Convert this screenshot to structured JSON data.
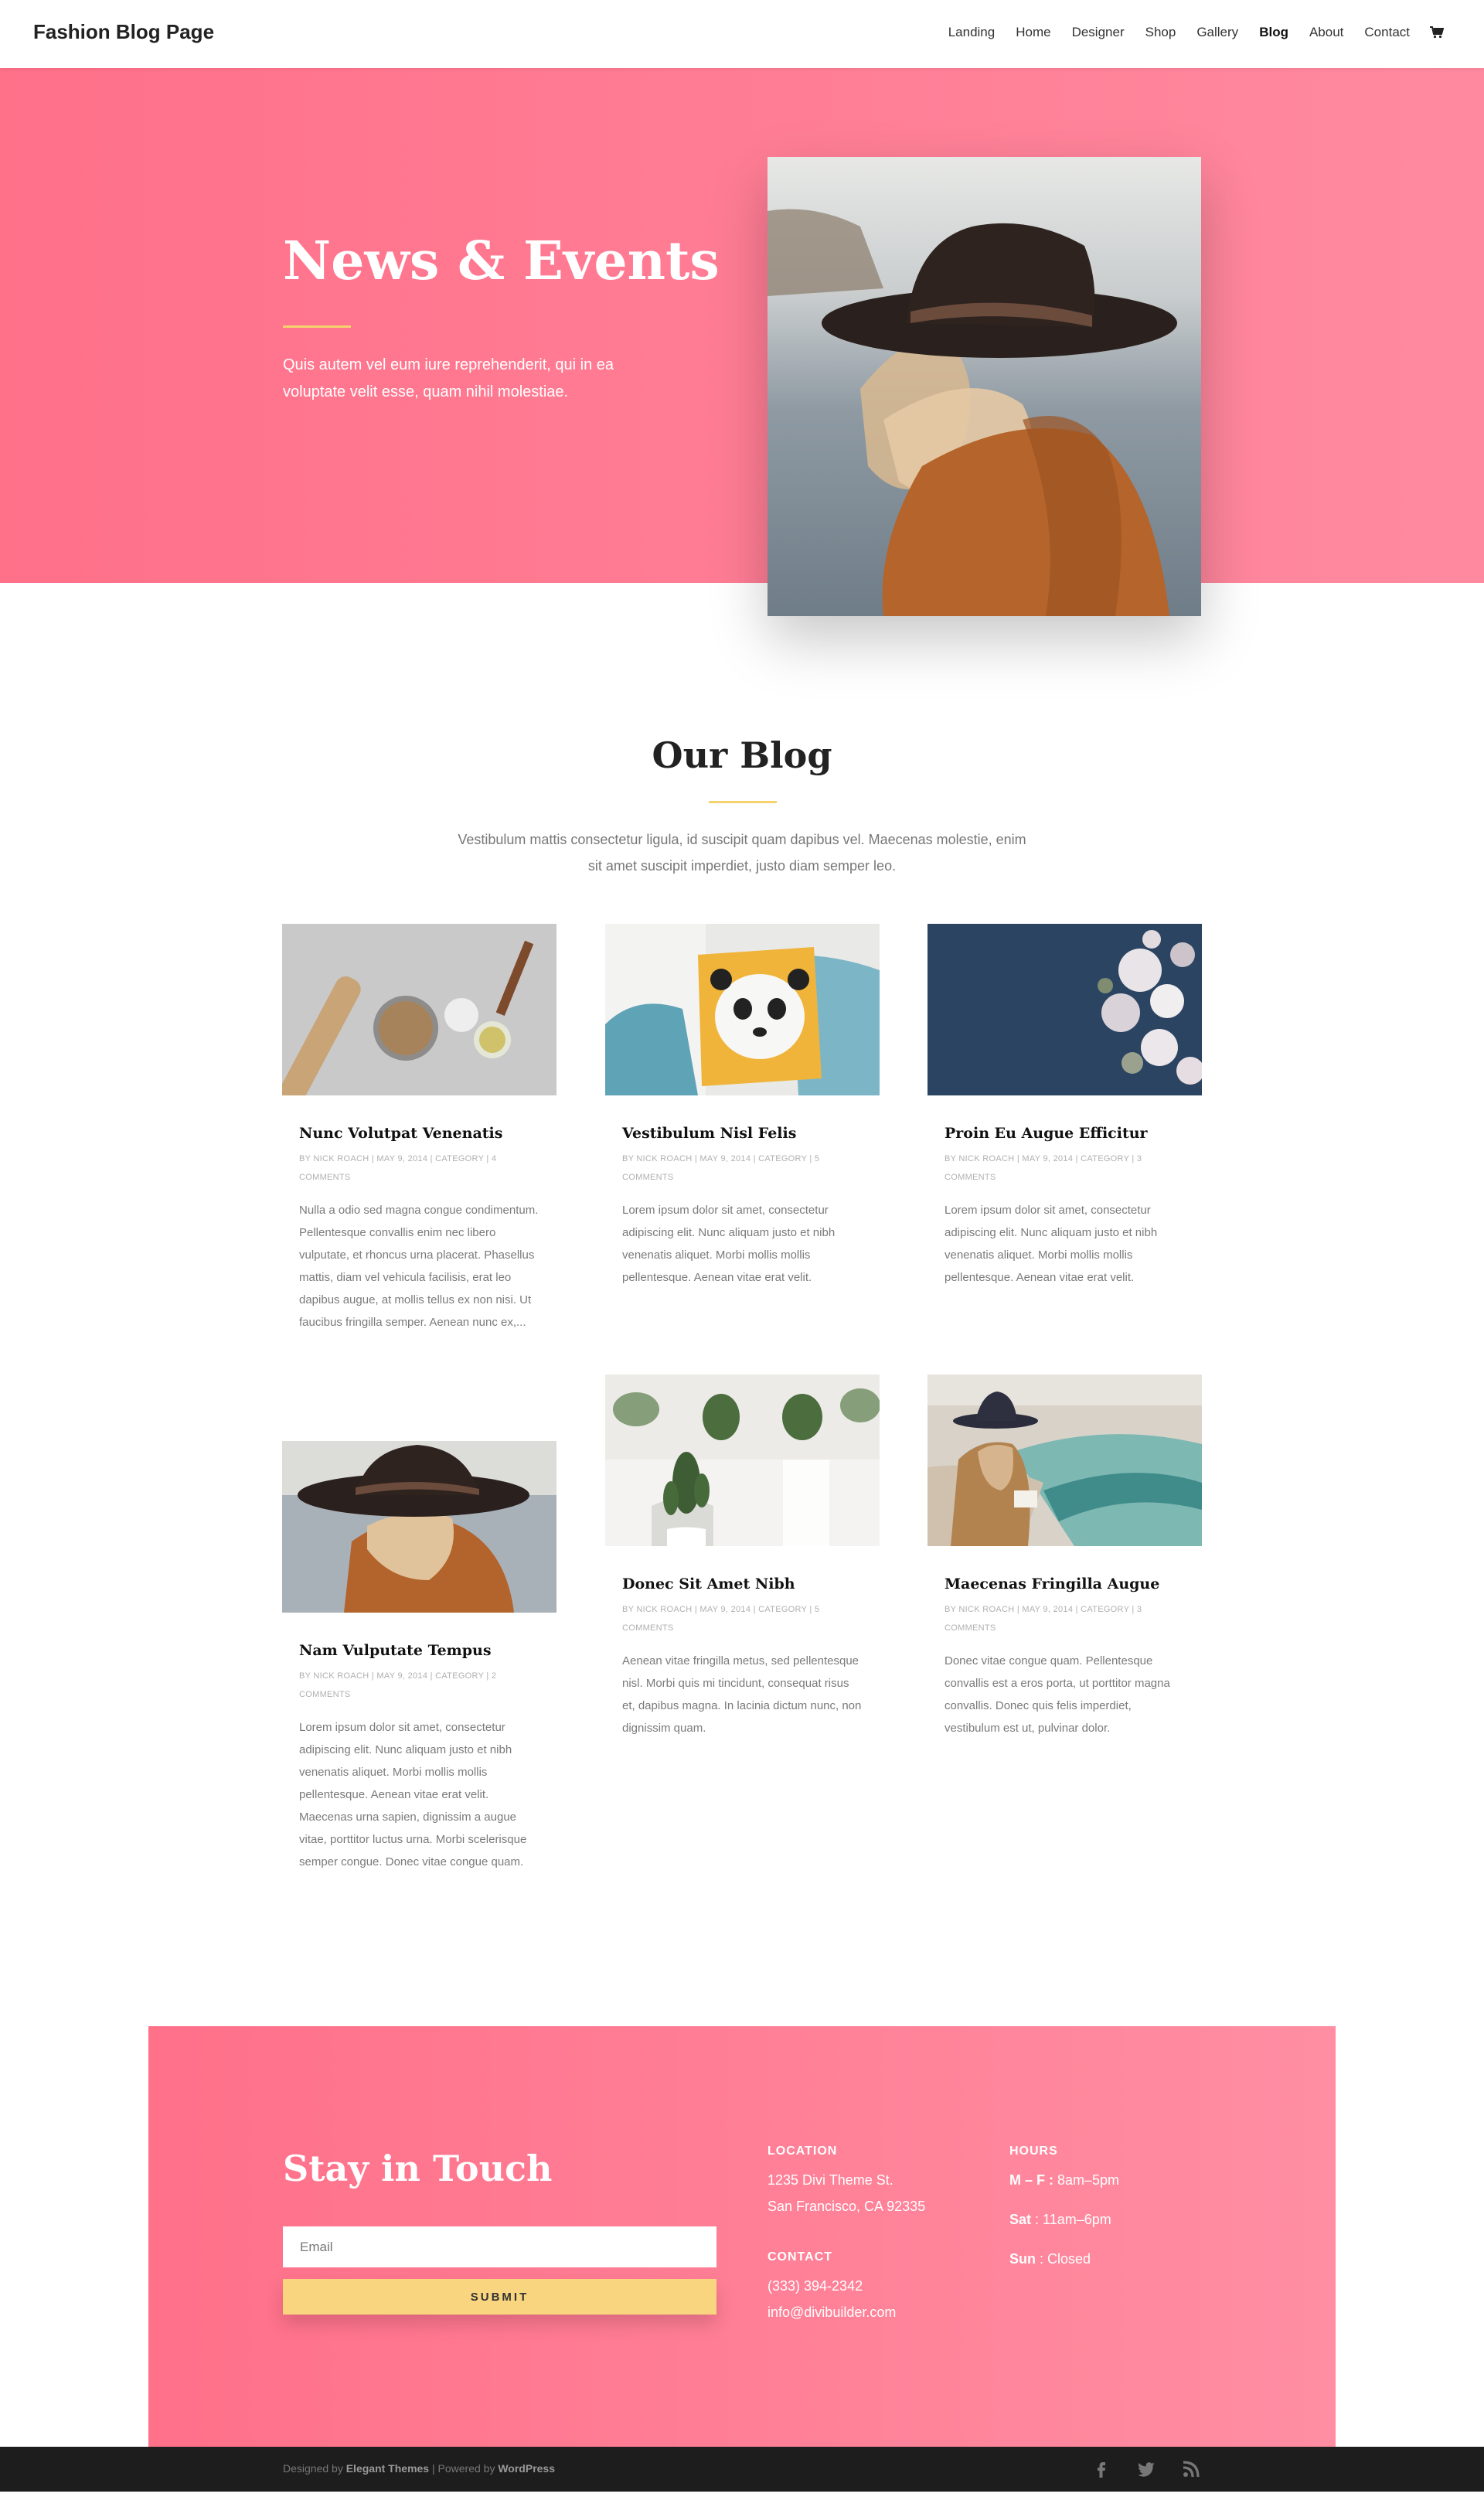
{
  "header": {
    "logo": "Fashion Blog Page",
    "nav": [
      "Landing",
      "Home",
      "Designer",
      "Shop",
      "Gallery",
      "Blog",
      "About",
      "Contact"
    ],
    "active": "Blog",
    "cart_icon": "cart-icon"
  },
  "hero": {
    "title": "News & Events",
    "text": "Quis autem vel eum iure reprehenderit, qui in ea voluptate velit esse, quam nihil molestiae.",
    "image": "woman-in-hat-photo"
  },
  "blog": {
    "title": "Our Blog",
    "intro": "Vestibulum mattis consectetur ligula, id suscipit quam dapibus vel. Maecenas molestie, enim sit amet suscipit imperdiet, justo diam semper leo.",
    "posts": [
      {
        "title": "Nunc Volutpat Venenatis",
        "meta": "BY NICK ROACH | MAY 9, 2014 | CATEGORY | 4 COMMENTS",
        "excerpt": "Nulla a odio sed magna congue condimentum. Pellentesque convallis enim nec libero vulputate, et rhoncus urna placerat. Phasellus mattis, diam vel vehicula facilisis, erat leo dapibus augue, at mollis tellus ex non nisi. Ut faucibus fringilla semper. Aenean nunc ex,...",
        "image": "baking-ingredients-photo"
      },
      {
        "title": "Vestibulum Nisl Felis",
        "meta": "BY NICK ROACH | MAY 9, 2014 | CATEGORY | 5 COMMENTS",
        "excerpt": "Lorem ipsum dolor sit amet, consectetur adipiscing elit. Nunc aliquam justo et nibh venenatis aliquet. Morbi mollis mollis pellentesque. Aenean vitae erat velit.",
        "image": "panda-pillow-photo"
      },
      {
        "title": "Proin Eu Augue Efficitur",
        "meta": "BY NICK ROACH | MAY 9, 2014 | CATEGORY | 3 COMMENTS",
        "excerpt": "Lorem ipsum dolor sit amet, consectetur adipiscing elit. Nunc aliquam justo et nibh venenatis aliquet. Morbi mollis mollis pellentesque. Aenean vitae erat velit.",
        "image": "flowers-photo"
      },
      {
        "title": "Nam Vulputate Tempus",
        "meta": "BY NICK ROACH | MAY 9, 2014 | CATEGORY | 2 COMMENTS",
        "excerpt": "Lorem ipsum dolor sit amet, consectetur adipiscing elit. Nunc aliquam justo et nibh venenatis aliquet. Morbi mollis mollis pellentesque. Aenean vitae erat velit. Maecenas urna sapien, dignissim a augue vitae, porttitor luctus urna. Morbi scelerisque semper congue. Donec vitae congue quam.",
        "image": "woman-in-hat-photo"
      },
      {
        "title": "Donec Sit Amet Nibh",
        "meta": "BY NICK ROACH | MAY 9, 2014 | CATEGORY | 5 COMMENTS",
        "excerpt": "Aenean vitae fringilla metus, sed pellentesque nisl. Morbi quis mi tincidunt, consequat risus et, dapibus magna. In lacinia dictum nunc, non dignissim quam.",
        "image": "cactus-photo"
      },
      {
        "title": "Maecenas Fringilla Augue",
        "meta": "BY NICK ROACH | MAY 9, 2014 | CATEGORY | 3 COMMENTS",
        "excerpt": "Donec vitae congue quam. Pellentesque convallis est a eros porta, ut porttitor magna convallis. Donec quis felis imperdiet, vestibulum est ut, pulvinar dolor.",
        "image": "woman-reading-boat-photo"
      }
    ]
  },
  "cta": {
    "title": "Stay in Touch",
    "email_placeholder": "Email",
    "submit": "SUBMIT",
    "location_head": "LOCATION",
    "address1": "1235 Divi Theme St.",
    "address2": "San Francisco, CA 92335",
    "contact_head": "CONTACT",
    "phone": "(333) 394-2342",
    "email": "info@divibuilder.com",
    "hours_head": "HOURS",
    "hours": [
      {
        "day": "M – F :",
        "time": " 8am–5pm"
      },
      {
        "day": "Sat",
        "time": " : 11am–6pm"
      },
      {
        "day": "Sun",
        "time": " : Closed"
      }
    ]
  },
  "footer": {
    "designed_by": "Designed by ",
    "elegant": "Elegant Themes",
    "sep": " | Powered by ",
    "wordpress": "WordPress",
    "social": [
      "facebook-icon",
      "twitter-icon",
      "rss-icon"
    ]
  },
  "colors": {
    "accent": "#ff7089",
    "divider": "#f4d36f",
    "submit": "#f8d57e",
    "footer": "#1d1d1d"
  }
}
